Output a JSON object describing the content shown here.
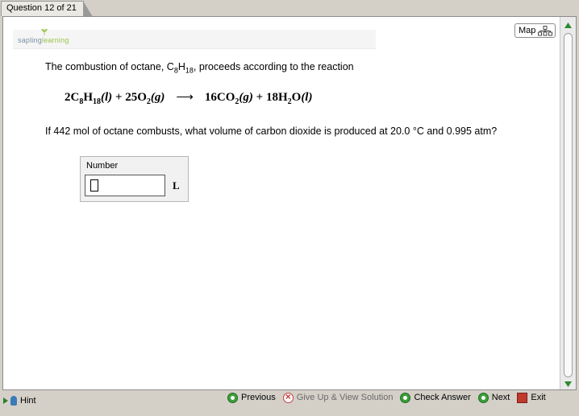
{
  "tab": {
    "label": "Question 12 of 21"
  },
  "logo": {
    "part1": "sapling",
    "part2": "learning"
  },
  "map_button": {
    "label": "Map"
  },
  "question": {
    "intro_before": "The combustion of octane, C",
    "intro_sub1": "8",
    "intro_mid": "H",
    "intro_sub2": "18",
    "intro_after": ", proceeds according to the reaction",
    "prompt": "If 442 mol of octane combusts, what volume of carbon dioxide is produced at 20.0 °C and 0.995 atm?"
  },
  "equation": {
    "r1_coef": "2C",
    "r1_sub1": "8",
    "r1_h": "H",
    "r1_sub2": "18",
    "r1_state": "(l)",
    "plus1": " + 25O",
    "r2_sub": "2",
    "r2_state": "(g)",
    "arrow": "⟶",
    "p1": "16CO",
    "p1_sub": "2",
    "p1_state": "(g)",
    "plus2": " + 18H",
    "p2_sub": "2",
    "p2_o": "O",
    "p2_state": "(l)"
  },
  "answer": {
    "label": "Number",
    "value": "",
    "unit": "L"
  },
  "nav": {
    "previous": "Previous",
    "give_up": "Give Up & View Solution",
    "check": "Check Answer",
    "next": "Next",
    "exit": "Exit"
  },
  "hint": {
    "label": "Hint"
  }
}
